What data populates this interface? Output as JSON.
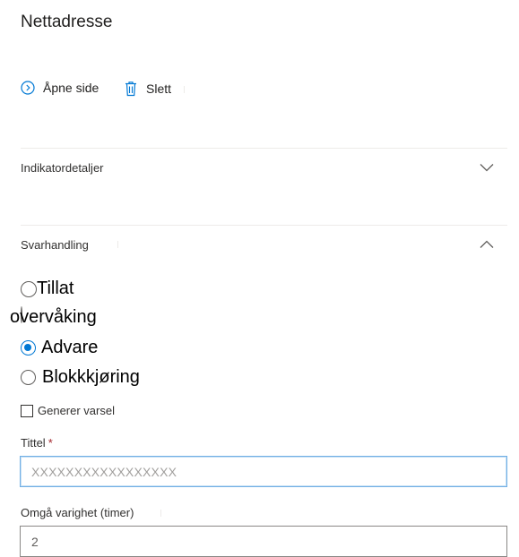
{
  "panel": {
    "title": "Nettadresse"
  },
  "actions": {
    "open_label": "Åpne side",
    "delete_label": "Slett"
  },
  "sections": {
    "indicator_details": "Indikatordetaljer",
    "response_action": "Svarhandling"
  },
  "response": {
    "options": [
      "Tillat",
      "overvåking",
      "Advare",
      "Blokkkjøring"
    ],
    "selected": "Advare"
  },
  "generate_alert": {
    "label": "Generer varsel",
    "checked": false
  },
  "title_field": {
    "label": "Tittel",
    "required_mark": "*",
    "placeholder": "XXXXXXXXXXXXXXXXX"
  },
  "duration_field": {
    "label": "Omgå varighet (timer)",
    "value": "2"
  },
  "colors": {
    "accent": "#0078d4",
    "required": "#a4262c",
    "divider": "#edebe9"
  }
}
